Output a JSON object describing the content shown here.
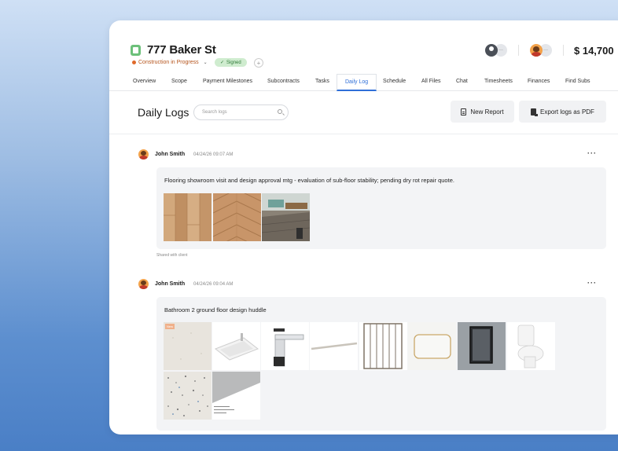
{
  "project": {
    "title": "777 Baker St",
    "status": "Construction in Progress",
    "signed_label": "Signed",
    "price": "$ 14,700",
    "colors": {
      "status": "#e0692a",
      "signed_bg": "#cfeccf",
      "accent": "#2f6fd8"
    }
  },
  "tabs": [
    {
      "label": "Overview"
    },
    {
      "label": "Scope"
    },
    {
      "label": "Payment Milestones"
    },
    {
      "label": "Subcontracts"
    },
    {
      "label": "Tasks"
    },
    {
      "label": "Daily Log",
      "active": true
    },
    {
      "label": "Schedule"
    },
    {
      "label": "All Files"
    },
    {
      "label": "Chat"
    },
    {
      "label": "Timesheets"
    },
    {
      "label": "Finances"
    },
    {
      "label": "Find Subs"
    }
  ],
  "daily_logs": {
    "title": "Daily Logs",
    "search_placeholder": "Search logs",
    "new_report_label": "New Report",
    "export_label": "Export logs as PDF"
  },
  "logs": [
    {
      "author": "John Smith",
      "time": "04/24/26 09:07 AM",
      "text": "Flooring showroom visit and design approval mtg - evaluation of sub-floor stability; pending dry rot repair quote.",
      "footer": "Shared with client",
      "images": [
        "light-oak-plank",
        "herringbone-oak",
        "dark-plank-room"
      ]
    },
    {
      "author": "John Smith",
      "time": "04/24/26 09:04 AM",
      "text": "Bathroom 2 ground floor design huddle",
      "images": [
        "white-stone-tile",
        "vessel-sink",
        "chrome-faucet",
        "towel-bar",
        "heated-towel-rack",
        "gold-mirror",
        "black-mirror",
        "toilet",
        "terrazzo-tile",
        "gray-tile-sample"
      ],
      "new_tag": "New"
    }
  ]
}
